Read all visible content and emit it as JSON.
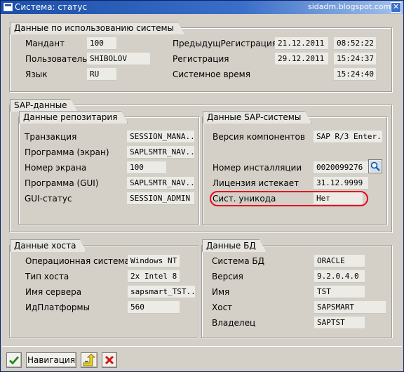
{
  "window": {
    "title": "Система: статус",
    "site": "sidadm.blogspot.com"
  },
  "usage": {
    "title": "Данные по использованию системы",
    "client_label": "Мандант",
    "client_value": "100",
    "user_label": "Пользователь",
    "user_value": "SHIBOLOV",
    "lang_label": "Язык",
    "lang_value": "RU",
    "prev_reg_label": "ПредыдущРегистрация",
    "prev_reg_date": "21.12.2011",
    "prev_reg_time": "08:52:22",
    "reg_label": "Регистрация",
    "reg_date": "29.12.2011",
    "reg_time": "15:24:37",
    "sys_time_label": "Системное время",
    "sys_time": "15:24:40"
  },
  "sap": {
    "title": "SAP-данные",
    "repo": {
      "title": "Данные репозитария",
      "trans_label": "Транзакция",
      "trans_value": "SESSION_MANA...",
      "prog_label": "Программа (экран)",
      "prog_value": "SAPLSMTR_NAV...",
      "screen_label": "Номер экрана",
      "screen_value": "100",
      "gui_prog_label": "Программа (GUI)",
      "gui_prog_value": "SAPLSMTR_NAV...",
      "gui_status_label": "GUI-статус",
      "gui_status_value": "SESSION_ADMIN"
    },
    "system": {
      "title": "Данные SAP-системы",
      "comp_label": "Версия компонентов",
      "comp_value": "SAP R/3 Enter...",
      "install_label": "Номер инсталляции",
      "install_value": "0020099276",
      "license_label": "Лицензия истекает",
      "license_value": "31.12.9999",
      "unicode_label": "Сист. уникода",
      "unicode_value": "Нет"
    }
  },
  "host": {
    "title": "Данные хоста",
    "os_label": "Операционная система",
    "os_value": "Windows NT",
    "type_label": "Тип хоста",
    "type_value": "2x Intel 8",
    "server_label": "Имя сервера",
    "server_value": "sapsmart_TST...",
    "platform_label": "ИдПлатформы",
    "platform_value": "560"
  },
  "db": {
    "title": "Данные БД",
    "sys_label": "Система БД",
    "sys_value": "ORACLE",
    "ver_label": "Версия",
    "ver_value": "9.2.0.4.0",
    "name_label": "Имя",
    "name_value": "TST",
    "host_label": "Хост",
    "host_value": "SAPSMART",
    "owner_label": "Владелец",
    "owner_value": "SAPTST"
  },
  "footer": {
    "nav_label": "Навигация"
  },
  "colors": {
    "highlight": "#e8001c",
    "titlebar": "#1c4fa8"
  }
}
